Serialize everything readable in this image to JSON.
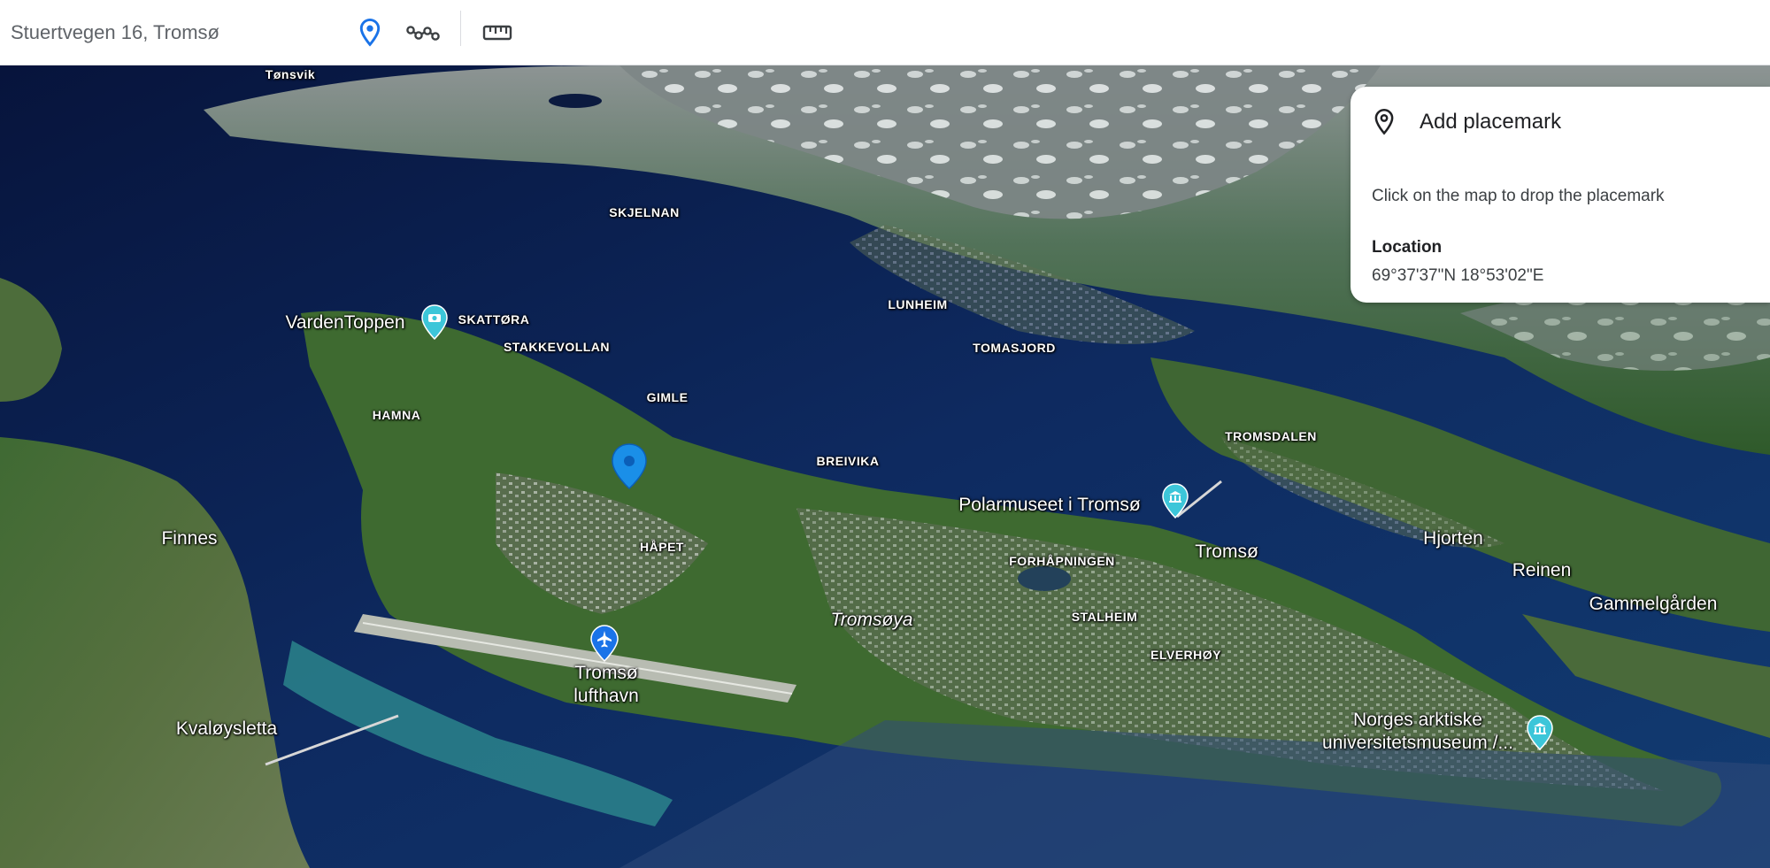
{
  "toolbar": {
    "search_value": "Stuertvegen 16, Tromsø",
    "tools": [
      {
        "name": "placemark-tool",
        "icon": "location-pin-icon",
        "active": true
      },
      {
        "name": "path-tool",
        "icon": "path-icon",
        "active": false
      },
      {
        "name": "measure-tool",
        "icon": "ruler-icon",
        "active": false
      }
    ]
  },
  "panel": {
    "title": "Add placemark",
    "hint": "Click on the map to drop the placemark",
    "location_label": "Location",
    "location_value": "69°37'37\"N 18°53'02\"E"
  },
  "map": {
    "labels": {
      "tonsvik": "Tønsvik",
      "skjelnan": "SKJELNAN",
      "lunheim": "LUNHEIM",
      "tomasjord": "TOMASJORD",
      "tromsdalen": "TROMSDALEN",
      "skattora": "SKATTØRA",
      "stakkevollan": "STAKKEVOLLAN",
      "gimle": "GIMLE",
      "hamna": "HAMNA",
      "breivika": "BREIVIKA",
      "hapet": "HÅPET",
      "forhapningen": "FORHÅPNINGEN",
      "stalheim": "STALHEIM",
      "elverhoy": "ELVERHØY",
      "finnes": "Finnes",
      "kvaloysletta": "Kvaløysletta",
      "tromsoya": "Tromsøya",
      "tromso": "Tromsø",
      "hjorten": "Hjorten",
      "reinen": "Reinen",
      "gammelgarden": "Gammelgården"
    },
    "pois": {
      "vardentoppen": "VardenToppen",
      "polarmuseet": "Polarmuseet i Tromsø",
      "airport_line1": "Tromsø",
      "airport_line2": "lufthavn",
      "museum_line1": "Norges arktiske",
      "museum_line2": "universitetsmuseum /..."
    },
    "colors": {
      "water_deep": "#0b1d4d",
      "water_mid": "#123a72",
      "shallow": "#2e8b8b",
      "land_green": "#3f6b30",
      "poi_teal": "#3cc6d9",
      "pin_blue": "#1a73e8"
    }
  }
}
